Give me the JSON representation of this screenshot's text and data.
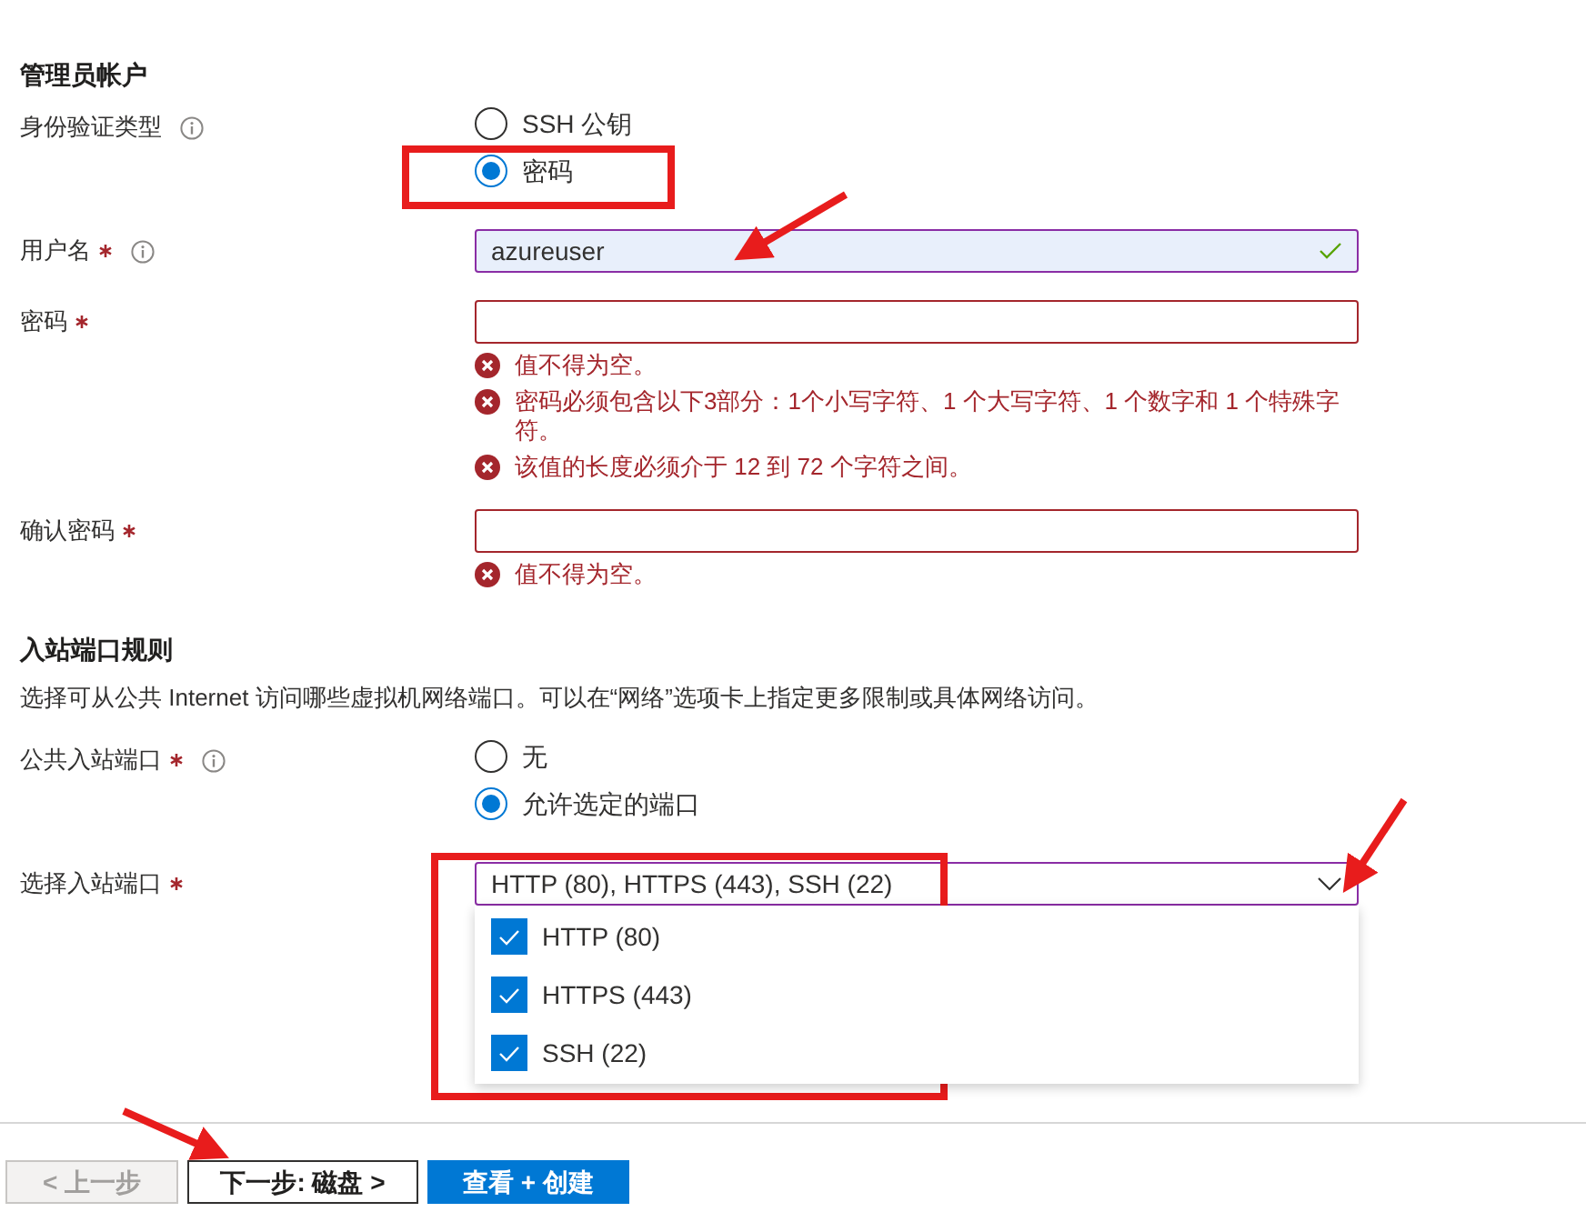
{
  "sections": [
    {
      "title": "管理员帐户",
      "fields": [
        {
          "kind": "radio",
          "label": "身份验证类型",
          "required": false,
          "info": true,
          "options": [
            {
              "label": "SSH 公钥",
              "selected": false
            },
            {
              "label": "密码",
              "selected": true
            }
          ]
        },
        {
          "kind": "text",
          "label": "用户名",
          "required": true,
          "info": true,
          "value": "azureuser",
          "valid": true
        },
        {
          "kind": "text",
          "label": "密码",
          "required": true,
          "info": false,
          "valid": false,
          "errors": [
            "值不得为空。",
            "密码必须包含以下3部分：1个小写字符、1 个大写字符、1 个数字和 1 个特殊字符。",
            "该值的长度必须介于 12 到 72 个字符之间。"
          ]
        },
        {
          "kind": "text",
          "label": "确认密码",
          "required": true,
          "info": false,
          "valid": false,
          "errors": [
            "值不得为空。"
          ]
        }
      ]
    },
    {
      "title": "入站端口规则",
      "description": "选择可从公共 Internet 访问哪些虚拟机网络端口。可以在“网络”选项卡上指定更多限制或具体网络访问。",
      "fields": [
        {
          "kind": "radio",
          "label": "公共入站端口",
          "required": true,
          "info": true,
          "options": [
            {
              "label": "无",
              "selected": false
            },
            {
              "label": "允许选定的端口",
              "selected": true
            }
          ]
        },
        {
          "kind": "multiselect",
          "label": "选择入站端口",
          "required": true,
          "info": false,
          "value": "HTTP (80), HTTPS (443), SSH (22)",
          "expanded": true,
          "options": [
            {
              "label": "HTTP (80)",
              "checked": true
            },
            {
              "label": "HTTPS (443)",
              "checked": true
            },
            {
              "label": "SSH (22)",
              "checked": true
            }
          ]
        }
      ]
    }
  ],
  "buttons": [
    {
      "label": "< 上一步",
      "kind": "secondary",
      "disabled": true
    },
    {
      "label": "下一步: 磁盘 >",
      "kind": "secondary",
      "disabled": false
    },
    {
      "label": "查看 + 创建",
      "kind": "primary",
      "disabled": false
    }
  ]
}
